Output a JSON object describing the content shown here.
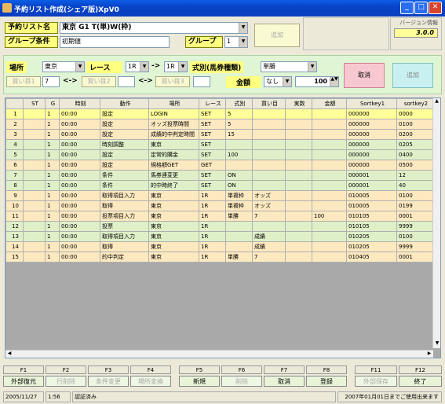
{
  "window": {
    "title": "予約リスト作成(シェア版)XpV0"
  },
  "top": {
    "list_name_label": "予約リスト名",
    "list_name_value": "東京  G1  T(単)W(枠)",
    "group_cond_label": "グループ条件",
    "group_cond_value": "初期値",
    "group_label": "グループ",
    "group_value": "1",
    "add_label": "追加",
    "version_label": "バージョン情報",
    "version_value": "3.0.0"
  },
  "filter": {
    "place_label": "場所",
    "place_value": "東京",
    "race_label": "レース",
    "race_from": "1R",
    "arrow": "->",
    "race_to": "1R",
    "type_label": "式別(馬券種類)",
    "type_value": "単勝",
    "buy1_label": "買い目1",
    "buy1_value": "7",
    "between1": "<->",
    "buy2_label": "買い目2",
    "between2": "<->",
    "buy3_label": "買い目3",
    "amount_label": "金額",
    "amount_mode": "なし",
    "amount_value": "100",
    "cancel_label": "取消",
    "add_label": "追加"
  },
  "table": {
    "headers": [
      "ST",
      "G",
      "時刻",
      "動作",
      "場所",
      "レース",
      "式別",
      "買い目",
      "実数",
      "金額",
      "Sortkey1",
      "sortkey2"
    ],
    "rows": [
      {
        "n": "1",
        "st": "",
        "g": "1",
        "time": "00:00",
        "action": "設定",
        "place": "LOGIN",
        "race": "SET",
        "type": "5",
        "buy": "",
        "real": "",
        "amt": "",
        "k1": "000000",
        "k2": "0000"
      },
      {
        "n": "2",
        "st": "",
        "g": "1",
        "time": "00:00",
        "action": "設定",
        "place": "オッズ投票時間",
        "race": "SET",
        "type": "5",
        "buy": "",
        "real": "",
        "amt": "",
        "k1": "000000",
        "k2": "0100"
      },
      {
        "n": "3",
        "st": "",
        "g": "1",
        "time": "00:00",
        "action": "設定",
        "place": "成績的中判定時間",
        "race": "SET",
        "type": "15",
        "buy": "",
        "real": "",
        "amt": "",
        "k1": "000000",
        "k2": "0200"
      },
      {
        "n": "4",
        "st": "",
        "g": "1",
        "time": "00:00",
        "action": "時刻調整",
        "place": "東京",
        "race": "SET",
        "type": "",
        "buy": "",
        "real": "",
        "amt": "",
        "k1": "000000",
        "k2": "0205"
      },
      {
        "n": "5",
        "st": "",
        "g": "1",
        "time": "00:00",
        "action": "設定",
        "place": "定常的購金",
        "race": "SET",
        "type": "100",
        "buy": "",
        "real": "",
        "amt": "",
        "k1": "000000",
        "k2": "0400"
      },
      {
        "n": "6",
        "st": "",
        "g": "1",
        "time": "00:00",
        "action": "設定",
        "place": "規格額GET",
        "race": "GET",
        "type": "",
        "buy": "",
        "real": "",
        "amt": "",
        "k1": "000000",
        "k2": "0500"
      },
      {
        "n": "7",
        "st": "",
        "g": "1",
        "time": "00:00",
        "action": "条件",
        "place": "馬券連変更",
        "race": "SET",
        "type": "ON",
        "buy": "",
        "real": "",
        "amt": "",
        "k1": "000001",
        "k2": "12"
      },
      {
        "n": "8",
        "st": "",
        "g": "1",
        "time": "00:00",
        "action": "条件",
        "place": "的中時終了",
        "race": "SET",
        "type": "ON",
        "buy": "",
        "real": "",
        "amt": "",
        "k1": "000001",
        "k2": "40"
      },
      {
        "n": "9",
        "st": "",
        "g": "1",
        "time": "00:00",
        "action": "取得項目入力",
        "place": "東京",
        "race": "1R",
        "type": "単複枠",
        "buy": "オッズ",
        "real": "",
        "amt": "",
        "k1": "010005",
        "k2": "0100"
      },
      {
        "n": "10",
        "st": "",
        "g": "1",
        "time": "00:00",
        "action": "取得",
        "place": "東京",
        "race": "1R",
        "type": "単複枠",
        "buy": "オッズ",
        "real": "",
        "amt": "",
        "k1": "010005",
        "k2": "0199"
      },
      {
        "n": "11",
        "st": "",
        "g": "1",
        "time": "00:00",
        "action": "投票項目入力",
        "place": "東京",
        "race": "1R",
        "type": "単勝",
        "buy": "7",
        "real": "",
        "amt": "100",
        "k1": "010105",
        "k2": "0001"
      },
      {
        "n": "12",
        "st": "",
        "g": "1",
        "time": "00:00",
        "action": "投票",
        "place": "東京",
        "race": "1R",
        "type": "",
        "buy": "",
        "real": "",
        "amt": "",
        "k1": "010105",
        "k2": "9999"
      },
      {
        "n": "13",
        "st": "",
        "g": "1",
        "time": "00:00",
        "action": "取得項目入力",
        "place": "東京",
        "race": "1R",
        "type": "",
        "buy": "成績",
        "real": "",
        "amt": "",
        "k1": "010205",
        "k2": "0100"
      },
      {
        "n": "14",
        "st": "",
        "g": "1",
        "time": "00:00",
        "action": "取得",
        "place": "東京",
        "race": "1R",
        "type": "",
        "buy": "成績",
        "real": "",
        "amt": "",
        "k1": "010205",
        "k2": "9999"
      },
      {
        "n": "15",
        "st": "",
        "g": "1",
        "time": "00:00",
        "action": "的中判定",
        "place": "東京",
        "race": "1R",
        "type": "単勝",
        "buy": "7",
        "real": "",
        "amt": "",
        "k1": "010405",
        "k2": "0001"
      }
    ]
  },
  "fkeys": {
    "keys": [
      "F1",
      "F2",
      "F3",
      "F4",
      "F5",
      "F6",
      "F7",
      "F8",
      "F11",
      "F12"
    ],
    "labels": [
      "外部復元",
      "行削除",
      "条件変更",
      "場所変換",
      "新規",
      "削除",
      "取消",
      "登録",
      "外部保存",
      "終了"
    ]
  },
  "status": {
    "date": "2005/11/27",
    "time": "1:56",
    "auth": "認証済み",
    "notice": "2007年01月01日までご使用出来ます"
  }
}
